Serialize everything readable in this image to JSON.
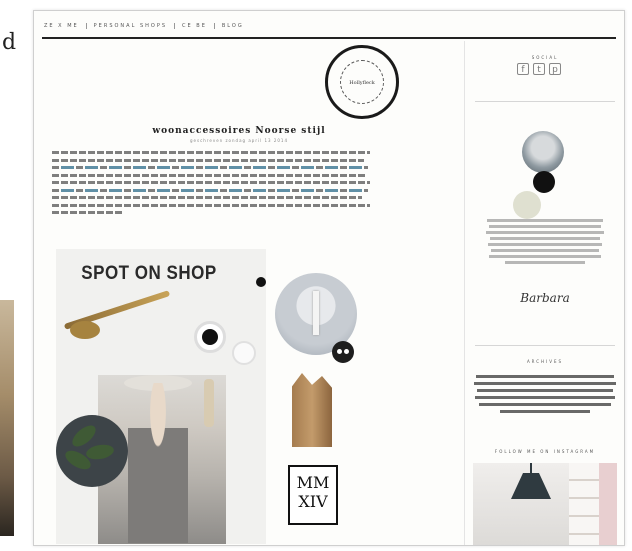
{
  "edge": {
    "letter": "d"
  },
  "blog": {
    "nav": [
      "ZE X ME",
      "PERSONAL SHOPS",
      "CE BE",
      "BLOG"
    ],
    "logo_text": "Hollyfleck",
    "post": {
      "title": "woonaccessoires Noorse stijl",
      "meta": "geschreven zondag april 13 2014"
    },
    "collage": {
      "spot_title": "SPOT ON SHOP",
      "poster_text": "MM XIV"
    },
    "sidebar": {
      "social_head": "SOCIAL",
      "social_icons": [
        "f",
        "t",
        "p"
      ],
      "signature": "Barbara",
      "tags_head": "ARCHIVES",
      "insta_head": "FOLLOW ME ON INSTAGRAM"
    }
  }
}
